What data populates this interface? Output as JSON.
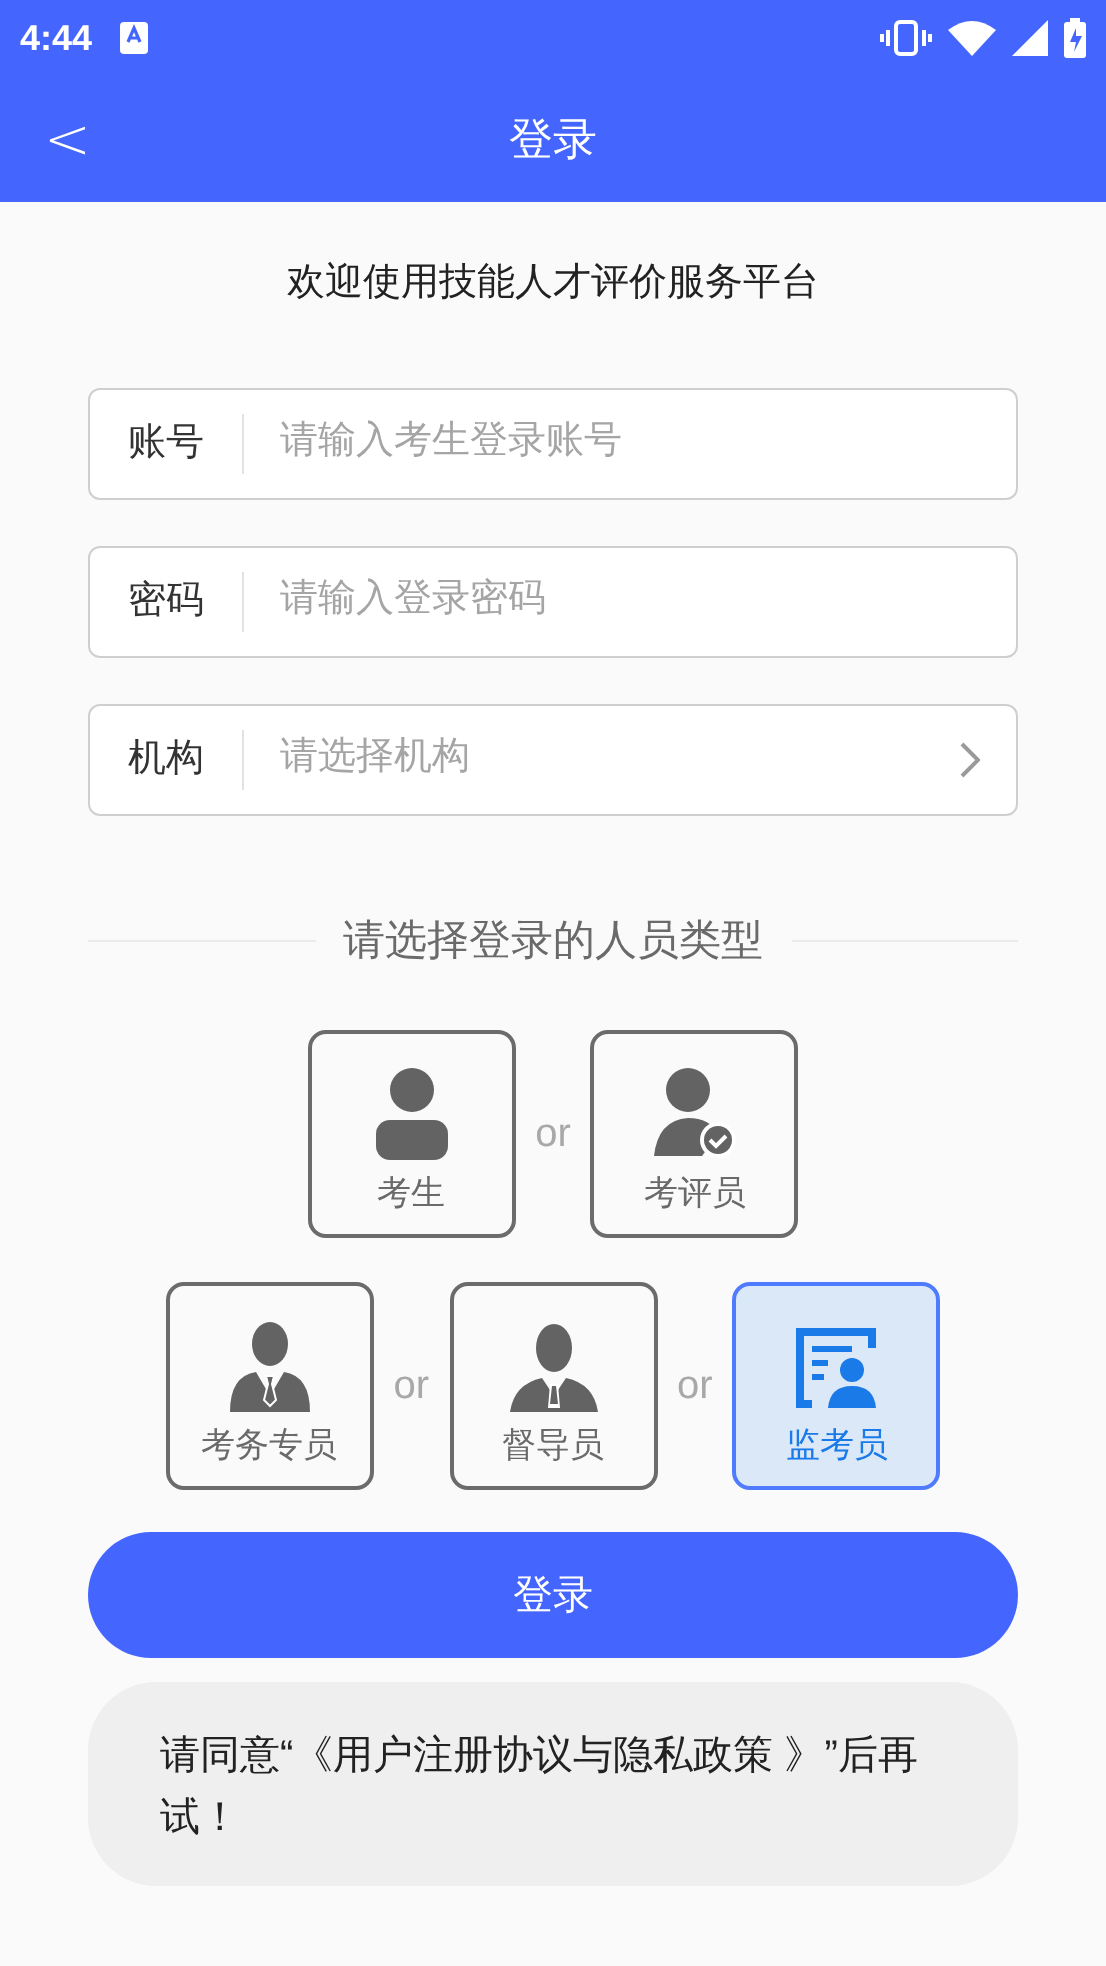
{
  "status_bar": {
    "time": "4:44"
  },
  "header": {
    "back": "<",
    "title": "登录"
  },
  "welcome": "欢迎使用技能人才评价服务平台",
  "fields": [
    {
      "kind": "text",
      "label": "账号",
      "placeholder": "请输入考生登录账号"
    },
    {
      "kind": "password",
      "label": "密码",
      "placeholder": "请输入登录密码"
    },
    {
      "kind": "select",
      "label": "机构",
      "placeholder": "请选择机构"
    }
  ],
  "role_prompt": "请选择登录的人员类型",
  "role_rows": [
    [
      {
        "kind": "student",
        "label": "考生",
        "selected": false
      },
      {
        "kind": "evaluator",
        "label": "考评员",
        "selected": false,
        "separator": "or"
      }
    ],
    [
      {
        "kind": "staff",
        "label": "考务专员",
        "selected": false
      },
      {
        "kind": "supervisor",
        "label": "督导员",
        "selected": false,
        "separator": "or"
      },
      {
        "kind": "proctor",
        "label": "监考员",
        "selected": true,
        "separator": "or"
      }
    ]
  ],
  "login_button": "登录",
  "toast": "请同意“《用户注册协议与隐私政策 》”后再试！"
}
